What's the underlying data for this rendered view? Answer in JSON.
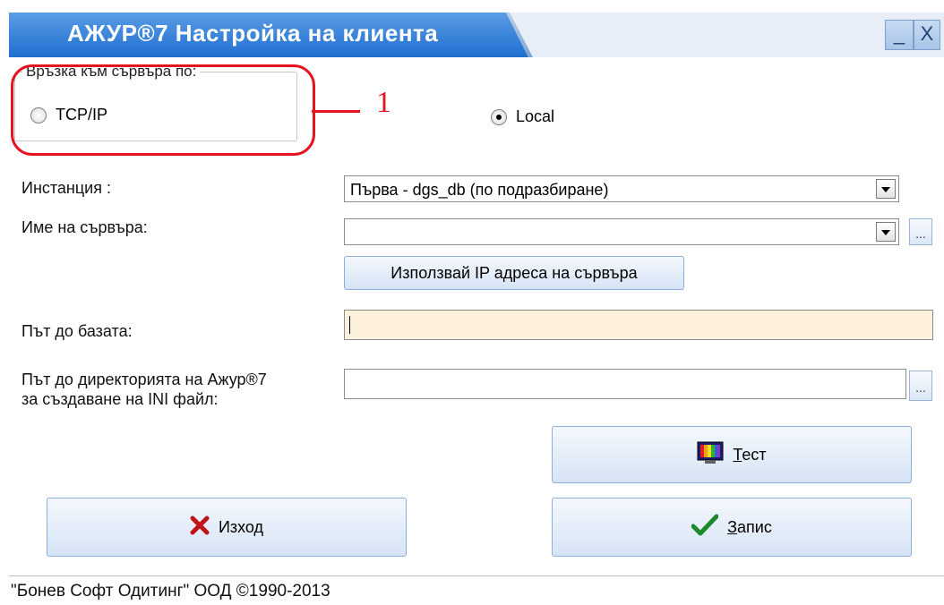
{
  "window": {
    "title": "АЖУР®7 Настройка на клиента",
    "minimize": "_",
    "close": "X"
  },
  "connection": {
    "group_label": "Връзка към сървъра по:",
    "tcp_label": "TCP/IP",
    "local_label": "Local",
    "selected": "Local",
    "annotation_number": "1"
  },
  "instance": {
    "label": "Инстанция :",
    "value": "Първа - dgs_db (по подразбиране)"
  },
  "server": {
    "label": "Име на сървъра:",
    "value": "",
    "browse": "...",
    "use_ip_button": "Използвай IP адреса на сървъра"
  },
  "db_path": {
    "label": "Път до базата:",
    "value": ""
  },
  "ini_path": {
    "label_line1": "Път до директорията на Ажур®7",
    "label_line2": "за създаване на INI файл:",
    "value": "",
    "browse": "..."
  },
  "buttons": {
    "test_first": "Т",
    "test_rest": "ест",
    "exit": "Изход",
    "save_first": "З",
    "save_rest": "апис"
  },
  "status_bar": {
    "text": "\"Бонев Софт Одитинг\" ООД  ©1990-2013"
  },
  "colors": {
    "title_blue": "#1f6fcf",
    "path_field": "#fdf1dc",
    "annotation_red": "#e4141e"
  }
}
